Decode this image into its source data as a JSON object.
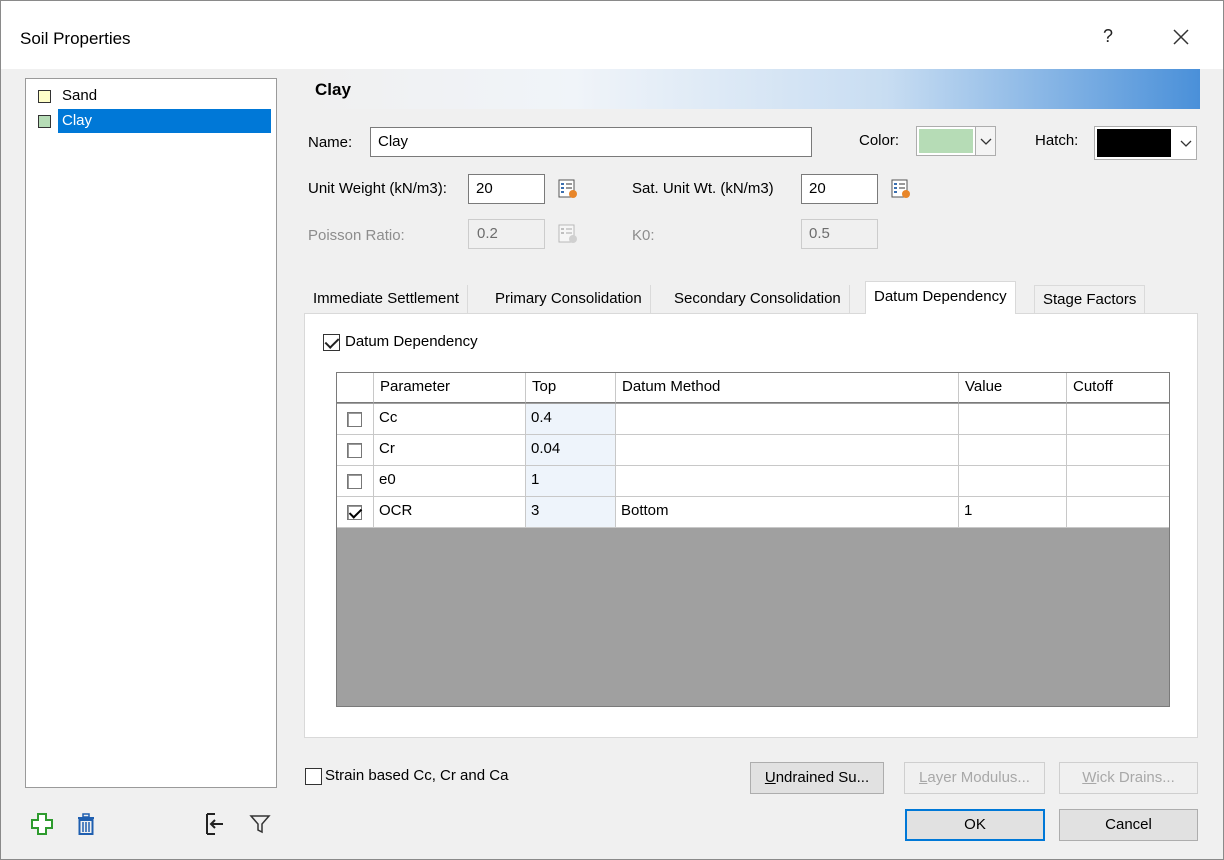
{
  "window": {
    "title": "Soil Properties",
    "help_label": "?",
    "close_icon": "close-icon"
  },
  "tree": {
    "items": [
      {
        "label": "Sand",
        "color": "#ffffc8",
        "selected": false
      },
      {
        "label": "Clay",
        "color": "#b6dcb6",
        "selected": true
      }
    ]
  },
  "toolbar_left": {
    "icons": [
      "add-icon",
      "delete-icon",
      "import-icon",
      "filter-icon"
    ]
  },
  "header": {
    "title": "Clay"
  },
  "form": {
    "name_label": "Name:",
    "name_value": "Clay",
    "color_label": "Color:",
    "color_value": "#b6dcb6",
    "hatch_label": "Hatch:",
    "hatch_value": "#000000",
    "unit_weight_label": "Unit Weight (kN/m3):",
    "unit_weight_value": "20",
    "sat_unit_wt_label": "Sat. Unit Wt. (kN/m3)",
    "sat_unit_wt_value": "20",
    "poisson_label": "Poisson Ratio:",
    "poisson_value": "0.2",
    "k0_label": "K0:",
    "k0_value": "0.5"
  },
  "tabs": [
    {
      "label": "Immediate Settlement",
      "active": false
    },
    {
      "label": "Primary Consolidation",
      "active": false
    },
    {
      "label": "Secondary Consolidation",
      "active": false
    },
    {
      "label": "Datum Dependency",
      "active": true
    },
    {
      "label": "Stage Factors",
      "active": false
    }
  ],
  "datum": {
    "checkbox_label": "Datum Dependency",
    "checked": true,
    "columns": [
      "",
      "Parameter",
      "Top",
      "Datum Method",
      "Value",
      "Cutoff"
    ],
    "rows": [
      {
        "checked": false,
        "parameter": "Cc",
        "top": "0.4",
        "method": "",
        "value": "",
        "cutoff": ""
      },
      {
        "checked": false,
        "parameter": "Cr",
        "top": "0.04",
        "method": "",
        "value": "",
        "cutoff": ""
      },
      {
        "checked": false,
        "parameter": "e0",
        "top": "1",
        "method": "",
        "value": "",
        "cutoff": ""
      },
      {
        "checked": true,
        "parameter": "OCR",
        "top": "3",
        "method": "Bottom",
        "value": "1",
        "cutoff": ""
      }
    ]
  },
  "footer": {
    "strain_label": "Strain based Cc, Cr and Ca",
    "undrained_label": "Undrained Su...",
    "layer_modulus_label": "Layer Modulus...",
    "wick_drains_label": "Wick Drains...",
    "ok_label": "OK",
    "cancel_label": "Cancel"
  }
}
